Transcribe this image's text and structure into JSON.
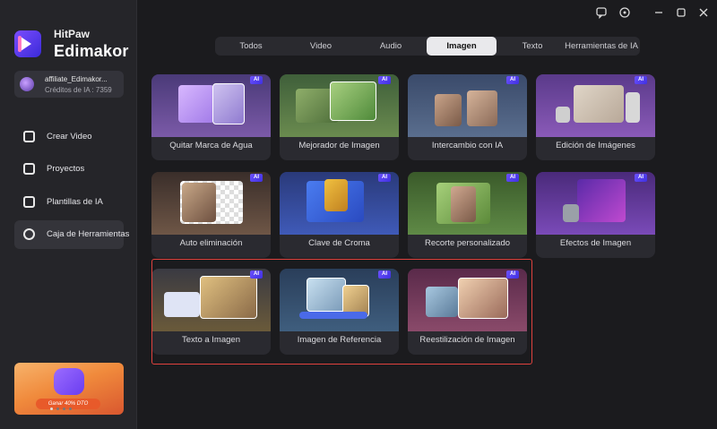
{
  "sidebar": {
    "brand_top": "HitPaw",
    "brand_name": "Edimakor",
    "account": {
      "name": "affiliate_Edimakor...",
      "credits": "Créditos de IA : 7359"
    },
    "nav": [
      {
        "label": "Crear Video",
        "icon": "video-icon"
      },
      {
        "label": "Proyectos",
        "icon": "folder-icon"
      },
      {
        "label": "Plantillas de IA",
        "icon": "template-icon"
      },
      {
        "label": "Caja de Herramientas",
        "icon": "toolbox-icon"
      }
    ],
    "promo": {
      "button_text": "Ganar 40% DTO"
    }
  },
  "window_controls": [
    "feedback-icon",
    "settings-icon",
    "minimize-icon",
    "maximize-icon",
    "close-icon"
  ],
  "tabs": [
    {
      "label": "Todos"
    },
    {
      "label": "Video"
    },
    {
      "label": "Audio"
    },
    {
      "label": "Imagen"
    },
    {
      "label": "Texto"
    },
    {
      "label": "Herramientas de IA"
    }
  ],
  "active_tab": "Imagen",
  "tools": [
    {
      "label": "Quitar Marca de Agua",
      "badge": "AI"
    },
    {
      "label": "Mejorador de Imagen",
      "badge": "AI"
    },
    {
      "label": "Intercambio con IA",
      "badge": "AI"
    },
    {
      "label": "Edición de Imágenes",
      "badge": "AI"
    },
    {
      "label": "Auto eliminación",
      "badge": "AI"
    },
    {
      "label": "Clave de Croma",
      "badge": "AI"
    },
    {
      "label": "Recorte personalizado",
      "badge": "AI"
    },
    {
      "label": "Efectos de Imagen",
      "badge": "AI"
    },
    {
      "label": "Texto a Imagen",
      "badge": "AI"
    },
    {
      "label": "Imagen de Referencia",
      "badge": "AI"
    },
    {
      "label": "Reestilización de Imagen",
      "badge": "AI"
    }
  ],
  "colors": {
    "accent": "#5b45f5",
    "highlight_border": "#e0423e",
    "background": "#1b1b1e",
    "sidebar": "#252529"
  }
}
